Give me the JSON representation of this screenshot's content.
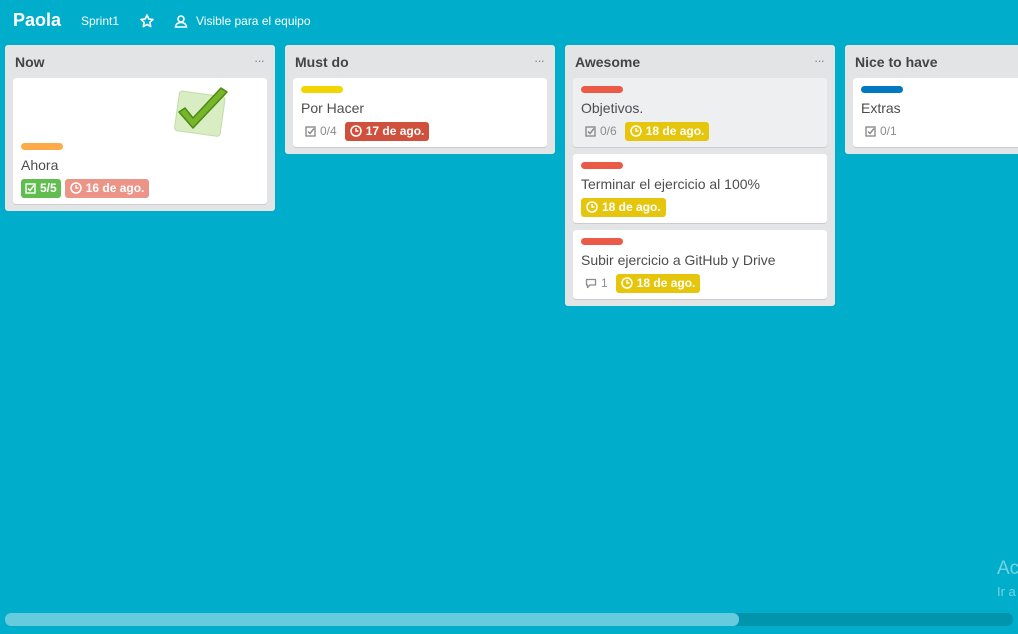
{
  "header": {
    "board_title": "Paola",
    "sprint_label": "Sprint1",
    "star_icon": "star-icon",
    "visibility_label": "Visible para el equipo"
  },
  "colors": {
    "background": "#00aecc",
    "label_orange": "#ffab4a",
    "label_yellow": "#f2d600",
    "label_red": "#eb5a46",
    "label_blue": "#0079bf",
    "badge_done": "#61bd4f",
    "badge_overdue": "#cf513d",
    "badge_past": "#ec9488",
    "badge_soon": "#e6c60d"
  },
  "lists": [
    {
      "title": "Now",
      "cards": [
        {
          "title": "Ahora",
          "checklist": "5/5",
          "due": "16 de ago."
        }
      ]
    },
    {
      "title": "Must do",
      "cards": [
        {
          "title": "Por Hacer",
          "checklist": "0/4",
          "due": "17 de ago."
        }
      ]
    },
    {
      "title": "Awesome",
      "cards": [
        {
          "title": "Objetivos.",
          "checklist": "0/6",
          "due": "18 de ago."
        },
        {
          "title": "Terminar el ejercicio al 100%",
          "due": "18 de ago."
        },
        {
          "title": "Subir ejercicio a GitHub y Drive",
          "comments": "1",
          "due": "18 de ago."
        }
      ]
    },
    {
      "title": "Nice to have",
      "cards": [
        {
          "title": "Extras",
          "checklist": "0/1"
        }
      ]
    }
  ],
  "watermark": {
    "line1": "Ac",
    "line2": "Ir a"
  },
  "scrollbar": {
    "thumb_fraction": 0.73
  }
}
